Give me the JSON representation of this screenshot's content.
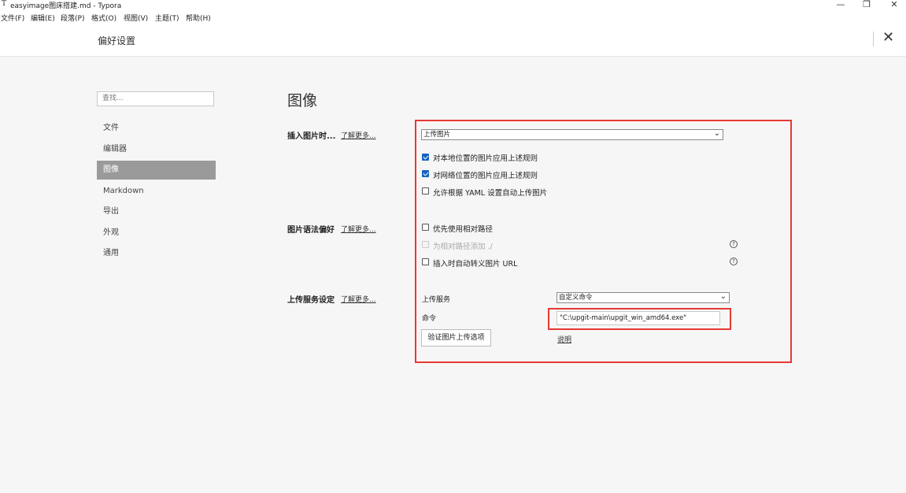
{
  "window": {
    "app_icon": "T",
    "title": "easyimage图床搭建.md - Typora",
    "controls": {
      "minimize": "—",
      "maximize": "❐",
      "close": "✕"
    }
  },
  "menu": [
    "文件(F)",
    "编辑(E)",
    "段落(P)",
    "格式(O)",
    "视图(V)",
    "主题(T)",
    "帮助(H)"
  ],
  "prefs": {
    "title": "偏好设置",
    "close": "✕"
  },
  "sidebar": {
    "search_placeholder": "查找...",
    "items": [
      "文件",
      "编辑器",
      "图像",
      "Markdown",
      "导出",
      "外观",
      "通用"
    ],
    "active": "图像"
  },
  "section": {
    "title": "图像",
    "insert": {
      "label": "插入图片时...",
      "learn_more": "了解更多...",
      "select_value": "上传图片",
      "options": [
        {
          "label": "对本地位置的图片应用上述规则",
          "checked": true
        },
        {
          "label": "对网络位置的图片应用上述规则",
          "checked": true
        },
        {
          "label": "允许根据 YAML 设置自动上传图片",
          "checked": false
        }
      ]
    },
    "syntax": {
      "label": "图片语法偏好",
      "learn_more": "了解更多...",
      "options": [
        {
          "label": "优先使用相对路径",
          "checked": false,
          "disabled": false
        },
        {
          "label": "为相对路径添加 ./",
          "checked": false,
          "disabled": true
        },
        {
          "label": "插入时自动转义图片 URL",
          "checked": false,
          "disabled": false
        }
      ],
      "help": "?"
    },
    "upload": {
      "label": "上传服务设定",
      "learn_more": "了解更多...",
      "service_label": "上传服务",
      "service_value": "自定义命令",
      "command_label": "命令",
      "command_value": "\"C:\\upgit-main\\upgit_win_amd64.exe\"",
      "verify_button": "验证图片上传选项",
      "explain_link": "说明"
    }
  },
  "colors": {
    "annotation": "#e53935",
    "checkbox": "#1565c0",
    "active_sidebar": "#9a9a9a"
  }
}
